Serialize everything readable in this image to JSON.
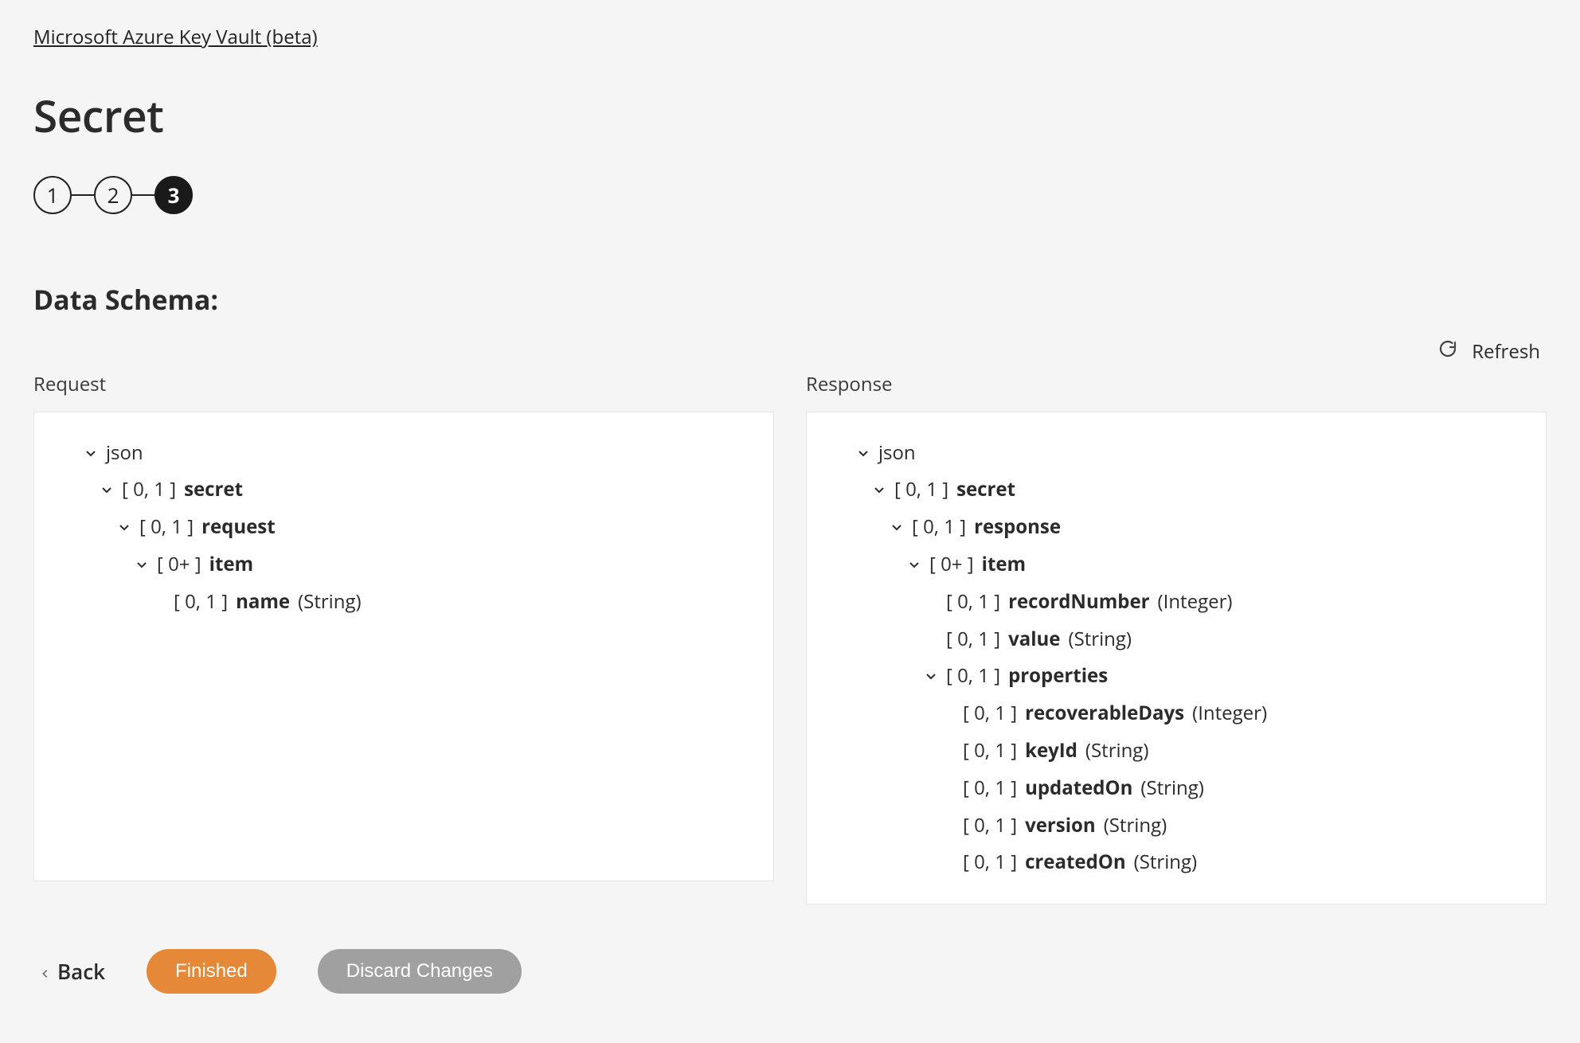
{
  "breadcrumb": "Microsoft Azure Key Vault (beta)",
  "page_title": "Secret",
  "stepper": {
    "steps": [
      "1",
      "2",
      "3"
    ],
    "active_index": 2
  },
  "section_heading": "Data Schema:",
  "refresh_label": "Refresh",
  "columns": {
    "request_label": "Request",
    "response_label": "Response"
  },
  "schema": {
    "request": {
      "root": "json",
      "nodes": [
        {
          "indent": 1,
          "chevron": true,
          "card": "[ 0, 1 ]",
          "name": "secret",
          "type": ""
        },
        {
          "indent": 2,
          "chevron": true,
          "card": "[ 0, 1 ]",
          "name": "request",
          "type": ""
        },
        {
          "indent": 3,
          "chevron": true,
          "card": "[ 0+ ]",
          "name": "item",
          "type": ""
        },
        {
          "indent": 4,
          "chevron": false,
          "card": "[ 0, 1 ]",
          "name": "name",
          "type": "(String)"
        }
      ]
    },
    "response": {
      "root": "json",
      "nodes": [
        {
          "indent": 1,
          "chevron": true,
          "card": "[ 0, 1 ]",
          "name": "secret",
          "type": ""
        },
        {
          "indent": 2,
          "chevron": true,
          "card": "[ 0, 1 ]",
          "name": "response",
          "type": ""
        },
        {
          "indent": 3,
          "chevron": true,
          "card": "[ 0+ ]",
          "name": "item",
          "type": ""
        },
        {
          "indent": 4,
          "chevron": false,
          "card": "[ 0, 1 ]",
          "name": "recordNumber",
          "type": "(Integer)"
        },
        {
          "indent": 4,
          "chevron": false,
          "card": "[ 0, 1 ]",
          "name": "value",
          "type": "(String)"
        },
        {
          "indent": 4,
          "chevron": true,
          "card": "[ 0, 1 ]",
          "name": "properties",
          "type": ""
        },
        {
          "indent": 5,
          "chevron": false,
          "card": "[ 0, 1 ]",
          "name": "recoverableDays",
          "type": "(Integer)"
        },
        {
          "indent": 5,
          "chevron": false,
          "card": "[ 0, 1 ]",
          "name": "keyId",
          "type": "(String)"
        },
        {
          "indent": 5,
          "chevron": false,
          "card": "[ 0, 1 ]",
          "name": "updatedOn",
          "type": "(String)"
        },
        {
          "indent": 5,
          "chevron": false,
          "card": "[ 0, 1 ]",
          "name": "version",
          "type": "(String)"
        },
        {
          "indent": 5,
          "chevron": false,
          "card": "[ 0, 1 ]",
          "name": "createdOn",
          "type": "(String)"
        }
      ]
    }
  },
  "footer": {
    "back_label": "Back",
    "finished_label": "Finished",
    "discard_label": "Discard Changes"
  }
}
